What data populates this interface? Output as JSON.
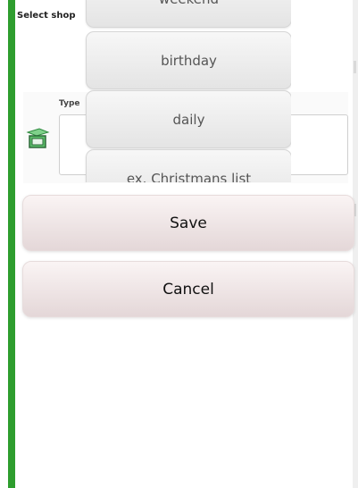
{
  "header": {
    "select_label": "Select shop"
  },
  "dropdown": {
    "options": [
      {
        "label": "weekend"
      },
      {
        "label": "birthday"
      },
      {
        "label": "daily"
      },
      {
        "label": "ex. Christmans list"
      }
    ]
  },
  "form": {
    "type_label": "Type",
    "type_value": ""
  },
  "buttons": {
    "save_label": "Save",
    "cancel_label": "Cancel"
  },
  "colors": {
    "accent_bar": "#2e9d2e",
    "button_top": "#faf4f4",
    "button_bottom": "#e4d7d8",
    "option_bg": "#eeeeee",
    "icon_green": "#2e8b3f"
  },
  "icons": [
    "shopping-list-icon"
  ]
}
